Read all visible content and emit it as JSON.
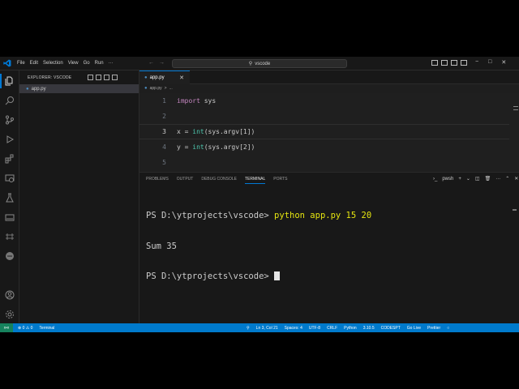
{
  "menu": [
    "File",
    "Edit",
    "Selection",
    "View",
    "Go",
    "Run",
    "···"
  ],
  "command_center": {
    "label": "vscode"
  },
  "window_controls": [
    "−",
    "□",
    "✕"
  ],
  "sidebar": {
    "title": "EXPLORER: VSCODE",
    "files": [
      {
        "name": "app.py"
      }
    ]
  },
  "editor": {
    "tab": {
      "name": "app.py",
      "close": "✕"
    },
    "breadcrumb": {
      "file": "app.py",
      "sep": ">",
      "more": "..."
    },
    "lines": [
      {
        "num": "1",
        "parts": [
          [
            "kw",
            "import"
          ],
          [
            "",
            " sys"
          ]
        ]
      },
      {
        "num": "2",
        "parts": []
      },
      {
        "num": "3",
        "parts": [
          [
            "",
            "x = "
          ],
          [
            "fn",
            "int"
          ],
          [
            "",
            "(sys.argv[1])"
          ]
        ]
      },
      {
        "num": "4",
        "parts": [
          [
            "",
            "y = "
          ],
          [
            "fn",
            "int"
          ],
          [
            "",
            "(sys.argv[2])"
          ]
        ]
      },
      {
        "num": "5",
        "parts": []
      }
    ]
  },
  "panel": {
    "tabs": [
      "PROBLEMS",
      "OUTPUT",
      "DEBUG CONSOLE",
      "TERMINAL",
      "PORTS"
    ],
    "active_tab": "TERMINAL",
    "shell": "pwsh",
    "terminal": {
      "line1_prompt": "PS D:\\ytprojects\\vscode> ",
      "line1_cmd": "python app.py 15 20",
      "line2": "Sum 35",
      "line3_prompt": "PS D:\\ytprojects\\vscode> "
    }
  },
  "statusbar": {
    "remote": "»«",
    "problems": "⊗ 0 ⚠ 0",
    "terminal": "Terminal",
    "position": "Ln 3, Col 21",
    "spaces": "Spaces: 4",
    "encoding": "UTF-8",
    "eol": "CRLF",
    "language": "Python",
    "interpreter": "3.10.5",
    "codesnap": "CODESPT",
    "golive": "Go Live",
    "prettier": "Prettier"
  },
  "colors": {
    "accent": "#007acc",
    "keyword": "#c586c0",
    "builtin": "#4ec9b0",
    "command": "#e5e510"
  }
}
